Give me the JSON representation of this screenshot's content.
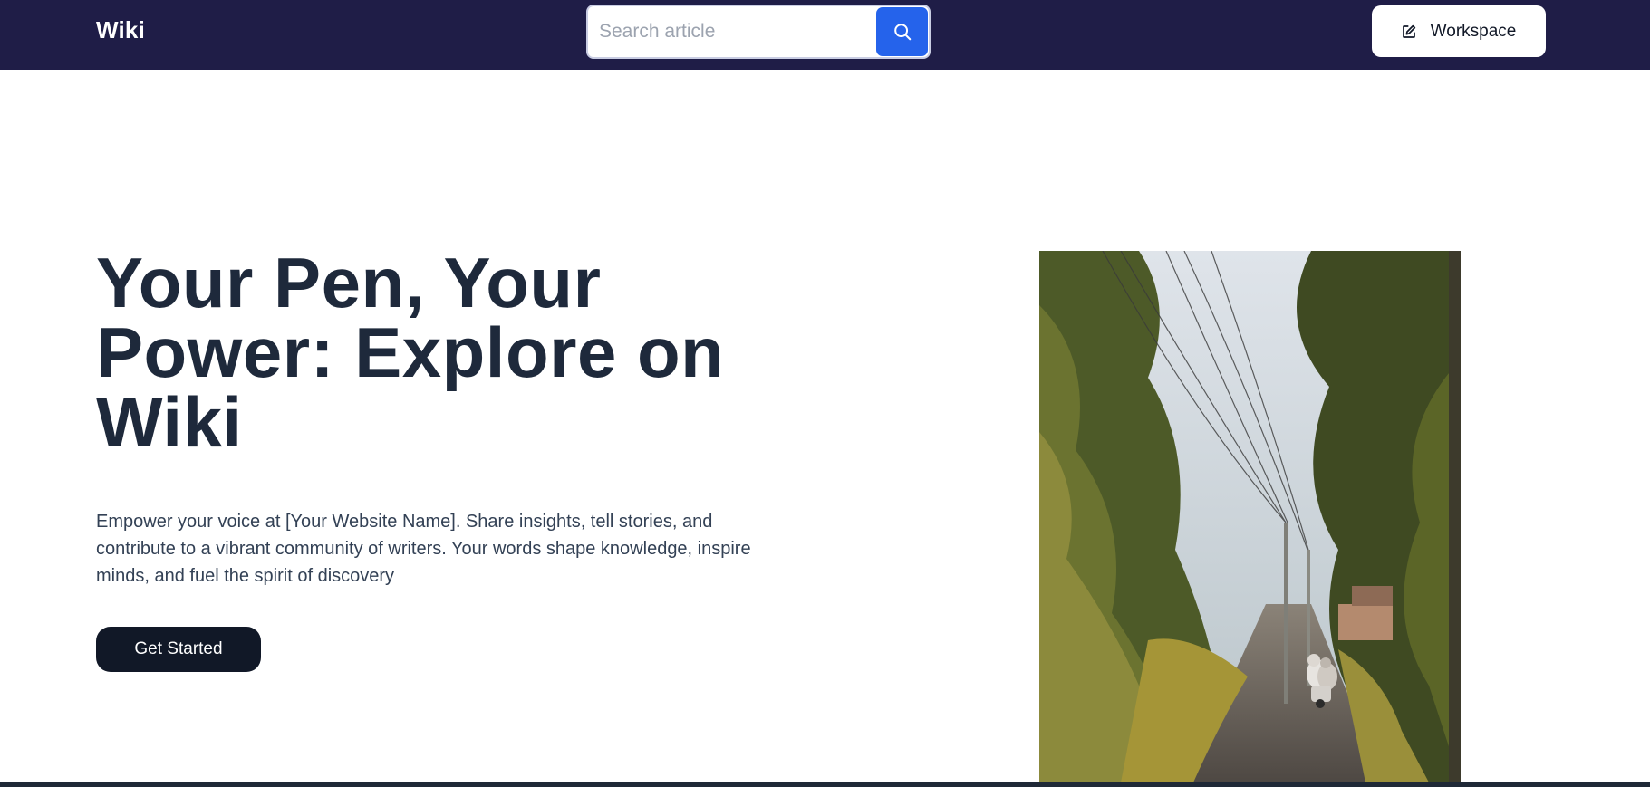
{
  "navbar": {
    "brand": "Wiki",
    "search_placeholder": "Search article",
    "workspace_label": "Workspace",
    "background_color": "#1f1d47"
  },
  "hero": {
    "title": "Your Pen, Your Power: Explore on Wiki",
    "description": "Empower your voice at [Your Website Name]. Share insights, tell stories, and contribute to a vibrant community of writers. Your words shape knowledge, inspire minds, and fuel the spirit of discovery",
    "cta_label": "Get Started"
  },
  "colors": {
    "accent": "#2563eb",
    "cta": "#111827",
    "heading": "#1e293b"
  },
  "icons": {
    "search": "search-icon",
    "workspace": "edit-icon"
  }
}
